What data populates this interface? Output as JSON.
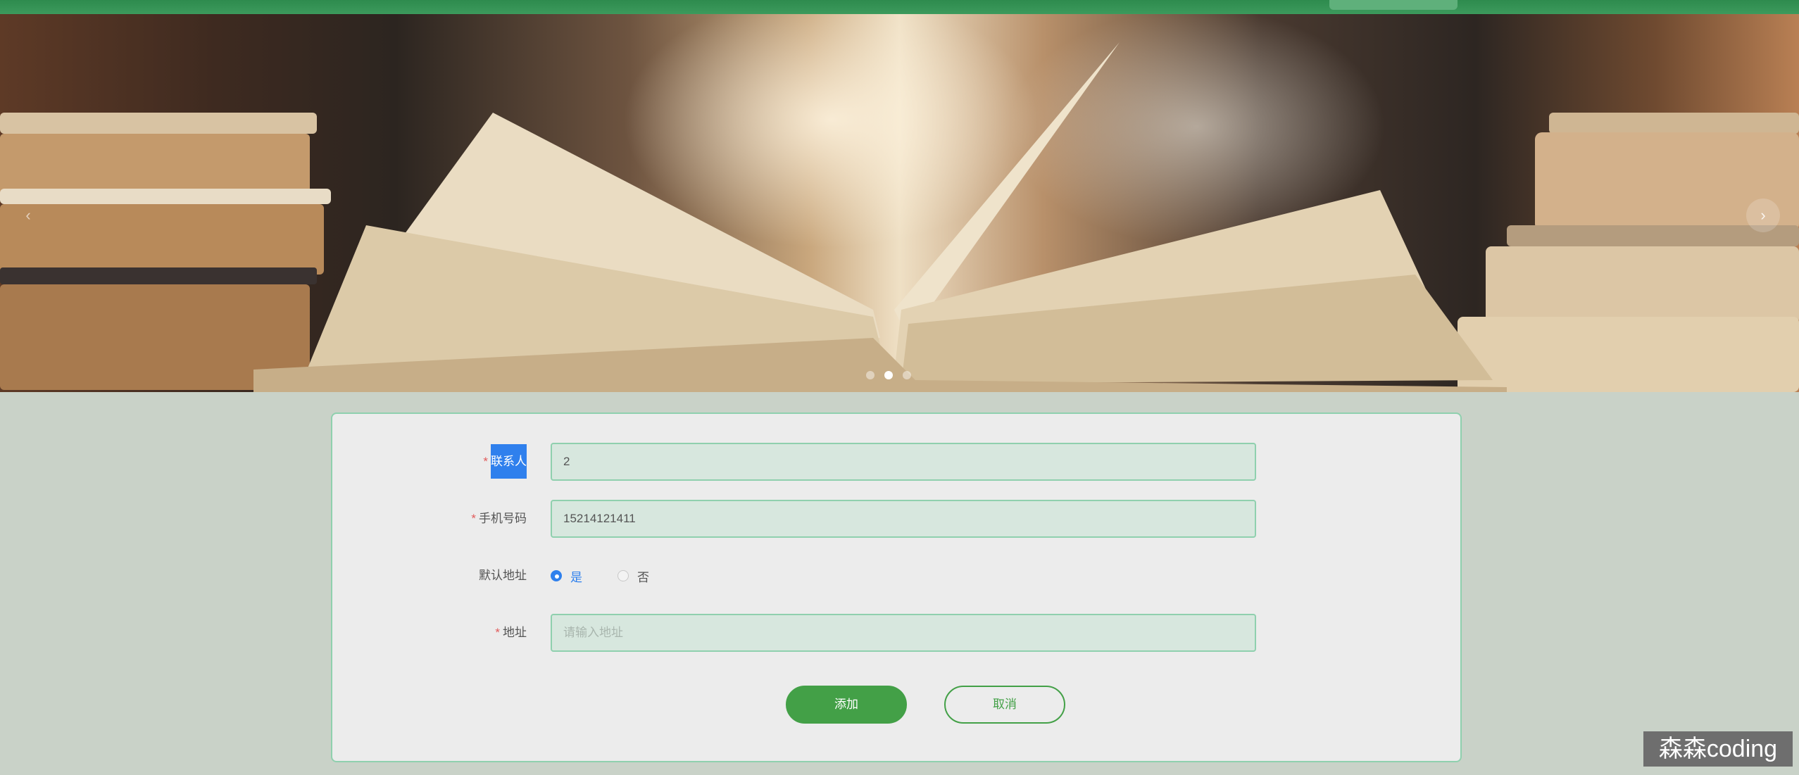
{
  "form": {
    "contact": {
      "label": "联系人",
      "required": "*",
      "value": "2"
    },
    "phone": {
      "label": "手机号码",
      "required": "*",
      "value": "15214121411"
    },
    "default_address": {
      "label": "默认地址",
      "options": [
        {
          "label": "是",
          "checked": true
        },
        {
          "label": "否",
          "checked": false
        }
      ]
    },
    "address": {
      "label": "地址",
      "required": "*",
      "placeholder": "请输入地址"
    }
  },
  "buttons": {
    "add": "添加",
    "cancel": "取消"
  },
  "carousel": {
    "next_label": "›",
    "prev_label": "‹"
  },
  "watermark": "森森coding",
  "colors": {
    "accent_green": "#43a047",
    "input_border": "#8fd0ae",
    "radio_selected": "#2f80ed",
    "required_star": "#e15b5b"
  }
}
